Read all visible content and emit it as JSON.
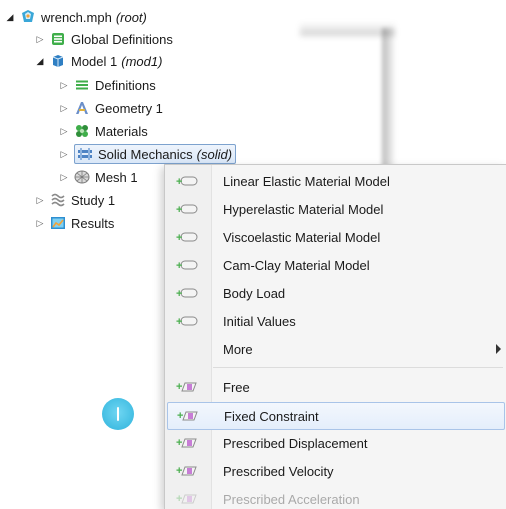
{
  "tree": {
    "root": {
      "label": "wrench.mph",
      "sub": "(root)",
      "icon": "comsol-model-icon"
    },
    "items": [
      {
        "label": "Global Definitions",
        "sub": "",
        "icon": "global-definitions-icon"
      },
      {
        "label": "Model 1",
        "sub": "(mod1)",
        "icon": "model-cube-icon"
      },
      {
        "label": "Definitions",
        "sub": "",
        "icon": "definitions-icon"
      },
      {
        "label": "Geometry 1",
        "sub": "",
        "icon": "geometry-icon"
      },
      {
        "label": "Materials",
        "sub": "",
        "icon": "materials-icon"
      },
      {
        "label": "Solid Mechanics",
        "sub": "(solid)",
        "icon": "solid-mechanics-icon"
      },
      {
        "label": "Mesh 1",
        "sub": "",
        "icon": "mesh-icon"
      },
      {
        "label": "Study 1",
        "sub": "",
        "icon": "study-icon"
      },
      {
        "label": "Results",
        "sub": "",
        "icon": "results-icon"
      }
    ]
  },
  "context_menu": {
    "items": [
      {
        "label": "Linear Elastic Material Model",
        "icon": "domain-node-add-icon"
      },
      {
        "label": "Hyperelastic Material Model",
        "icon": "domain-node-add-icon"
      },
      {
        "label": "Viscoelastic Material Model",
        "icon": "domain-node-add-icon"
      },
      {
        "label": "Cam-Clay Material Model",
        "icon": "domain-node-add-icon"
      },
      {
        "label": "Body Load",
        "icon": "domain-node-add-icon"
      },
      {
        "label": "Initial Values",
        "icon": "domain-node-add-icon"
      },
      {
        "label": "More",
        "icon": "submenu-arrow-icon"
      },
      {
        "label": "Free",
        "icon": "boundary-node-add-icon"
      },
      {
        "label": "Fixed Constraint",
        "icon": "boundary-node-add-icon"
      },
      {
        "label": "Prescribed Displacement",
        "icon": "boundary-node-add-icon"
      },
      {
        "label": "Prescribed Velocity",
        "icon": "boundary-node-add-icon"
      },
      {
        "label": "Prescribed Acceleration",
        "icon": "boundary-node-add-icon"
      }
    ],
    "highlighted": "Fixed Constraint"
  },
  "colors": {
    "selection_border": "#7da2ce",
    "highlight_border": "#a9c4e8",
    "plus_green": "#4caf50",
    "touch_blue": "#2fb3dc"
  }
}
